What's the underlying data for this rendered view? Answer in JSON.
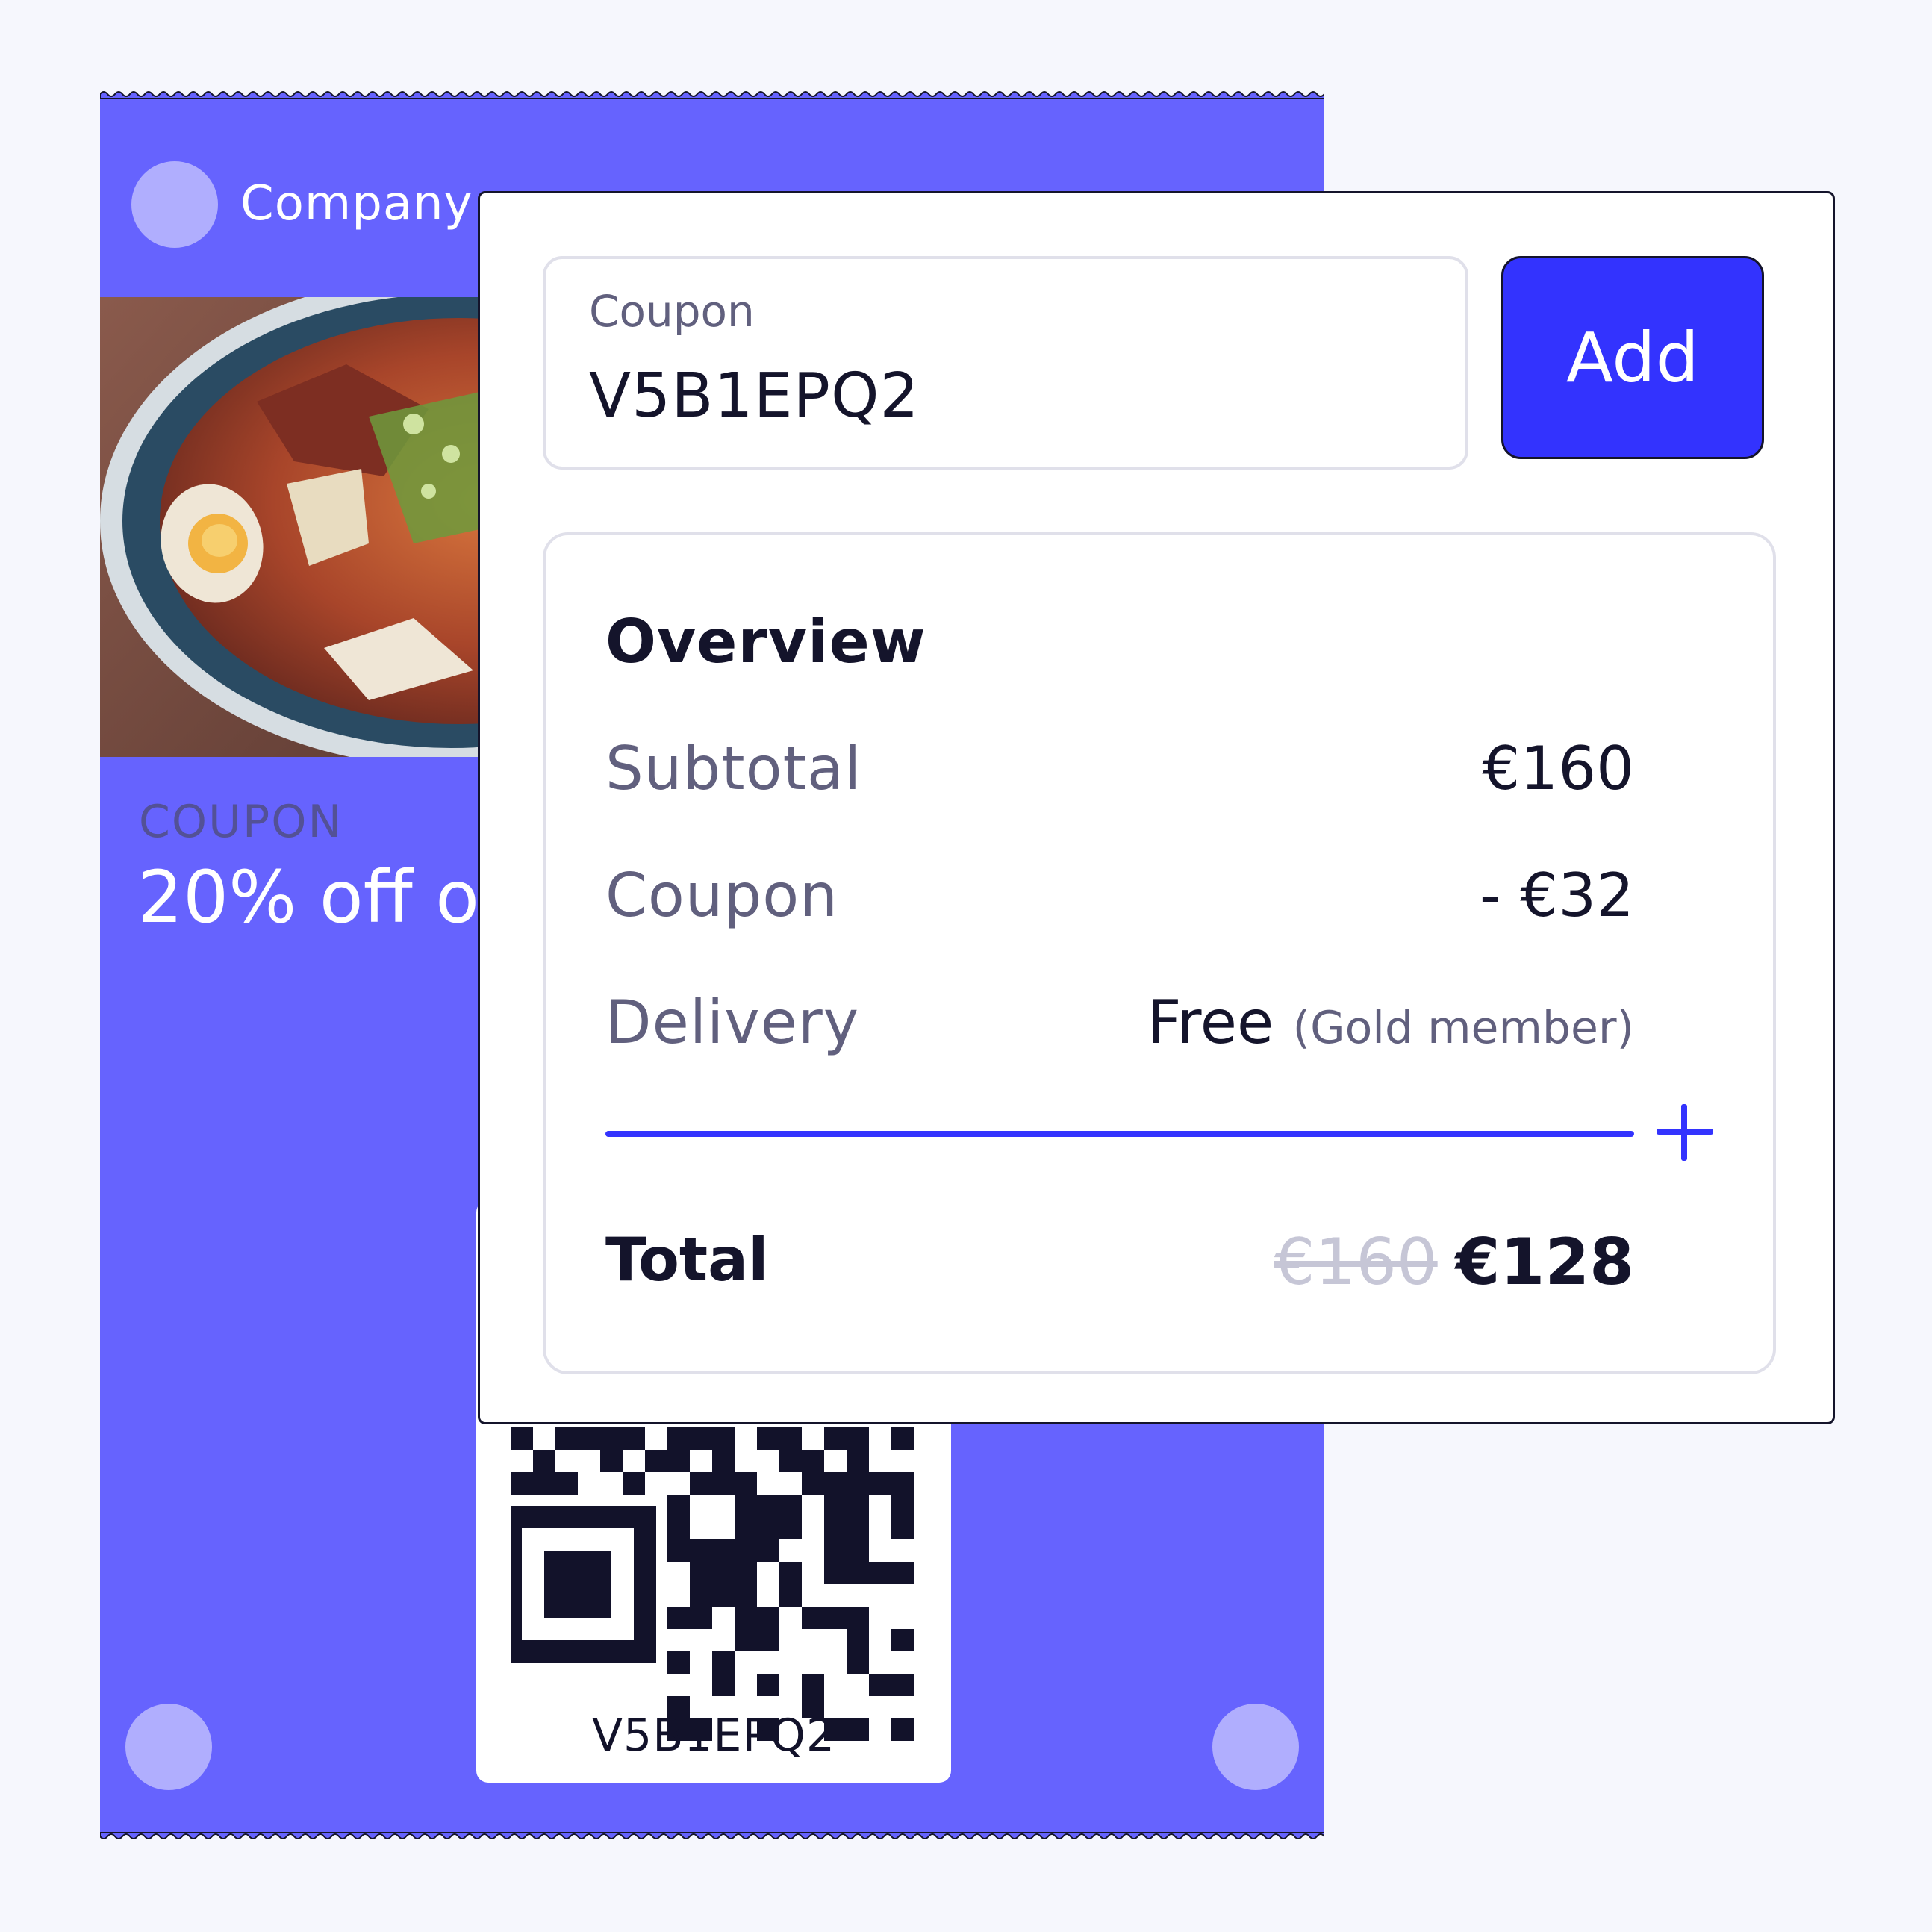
{
  "ticket": {
    "brand": "Company",
    "kicker": "COUPON",
    "headline": "20% off or",
    "qr_code_text": "V5B1EPQ2"
  },
  "coupon_input": {
    "label": "Coupon",
    "value": "V5B1EPQ2"
  },
  "add_button": {
    "label": "Add"
  },
  "overview": {
    "title": "Overview",
    "rows": [
      {
        "label": "Subtotal",
        "value": "€160",
        "note": ""
      },
      {
        "label": "Coupon",
        "value": "- €32",
        "note": ""
      },
      {
        "label": "Delivery",
        "value": "Free",
        "note": "(Gold member)"
      }
    ],
    "total": {
      "label": "Total",
      "old_value": "€160",
      "value": "€128"
    }
  },
  "colors": {
    "accent": "#3333fe",
    "ticket": "#6663fe",
    "ticket_light": "#b0aefe",
    "text_dark": "#14142b",
    "text_muted": "#61607e"
  },
  "icons": [
    "plus-icon",
    "qr-code-icon"
  ]
}
